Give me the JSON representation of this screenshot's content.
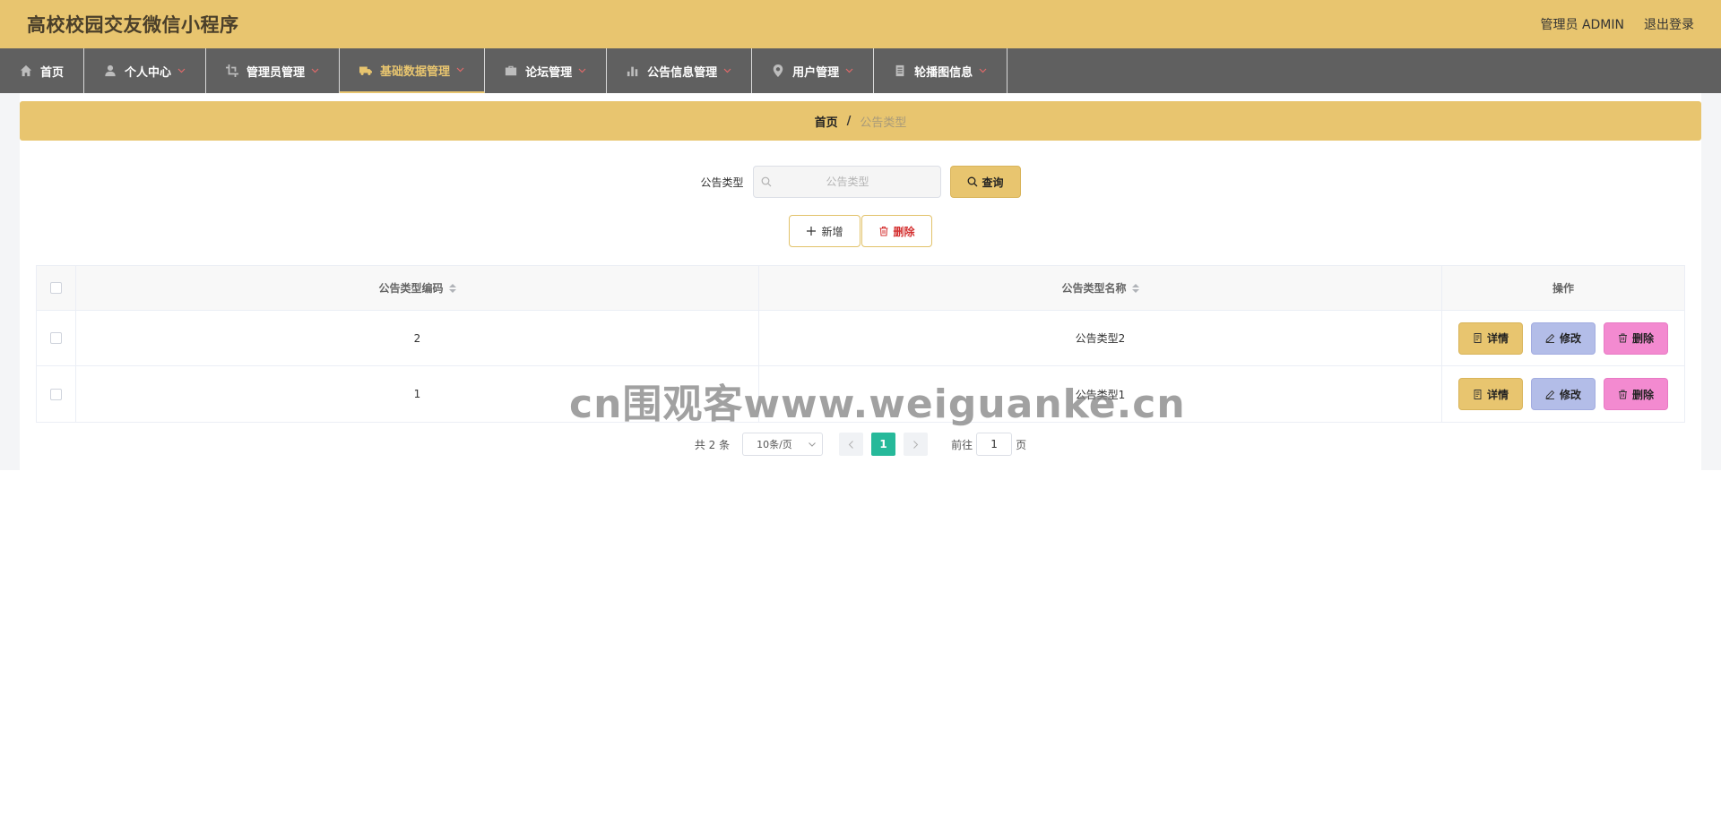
{
  "header": {
    "title": "高校校园交友微信小程序",
    "user_label": "管理员 ADMIN",
    "logout_label": "退出登录"
  },
  "nav": {
    "items": [
      {
        "label": "首页",
        "icon": "home-icon",
        "has_dropdown": false
      },
      {
        "label": "个人中心",
        "icon": "user-icon",
        "has_dropdown": true
      },
      {
        "label": "管理员管理",
        "icon": "crop-icon",
        "has_dropdown": true
      },
      {
        "label": "基础数据管理",
        "icon": "truck-icon",
        "has_dropdown": true,
        "active": true
      },
      {
        "label": "论坛管理",
        "icon": "briefcase-icon",
        "has_dropdown": true
      },
      {
        "label": "公告信息管理",
        "icon": "bar-chart-icon",
        "has_dropdown": true
      },
      {
        "label": "用户管理",
        "icon": "location-icon",
        "has_dropdown": true
      },
      {
        "label": "轮播图信息",
        "icon": "document-icon",
        "has_dropdown": true
      }
    ]
  },
  "breadcrumb": {
    "home": "首页",
    "separator": "/",
    "current": "公告类型"
  },
  "search": {
    "label": "公告类型",
    "placeholder": "公告类型",
    "button_label": "查询"
  },
  "actions": {
    "add_label": "新增",
    "delete_label": "删除"
  },
  "table": {
    "headers": {
      "code": "公告类型编码",
      "name": "公告类型名称",
      "ops": "操作"
    },
    "rows": [
      {
        "code": "2",
        "name": "公告类型2"
      },
      {
        "code": "1",
        "name": "公告类型1"
      }
    ],
    "row_actions": {
      "detail": "详情",
      "edit": "修改",
      "delete": "删除"
    }
  },
  "pagination": {
    "total": "共 2 条",
    "page_size": "10条/页",
    "current_page": "1",
    "goto_prefix": "前往",
    "goto_value": "1",
    "goto_suffix": "页"
  },
  "watermark": "cn围观客www.weiguanke.cn",
  "colors": {
    "header_bg": "#e8c56f",
    "nav_bg": "#606060",
    "nav_active": "#e8c56f",
    "detail_btn": "#e8c56f",
    "edit_btn": "#b3bde8",
    "delete_btn": "#f38ad0",
    "page_active": "#26b99a",
    "danger_text": "#d43030"
  }
}
